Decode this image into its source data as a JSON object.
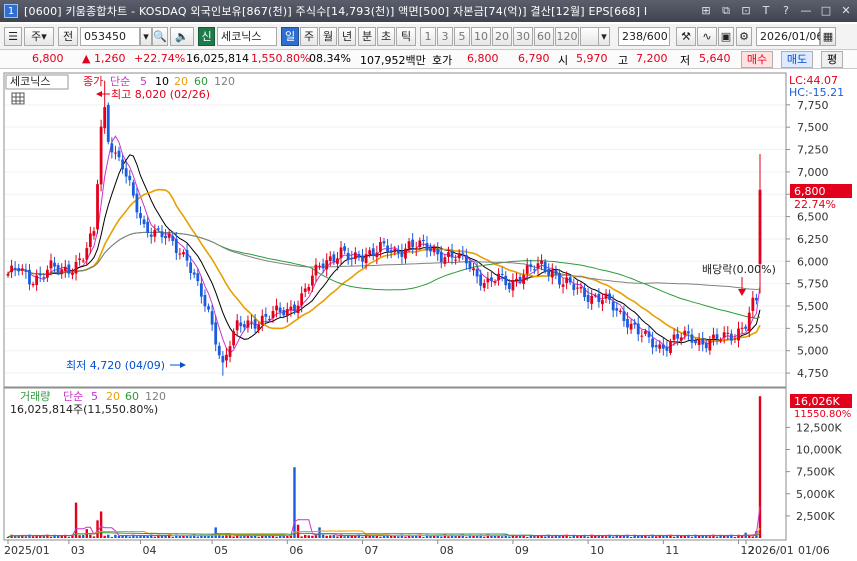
{
  "titlebar": {
    "app_number": "1",
    "title": "[0600] 키움종합차트 - KOSDAQ 외국인보유[867(천)] 주식수[14,793(천)] 액면[500] 자본금[74(억)] 결산[12월] EPS[668] I",
    "icons": [
      "link-icon",
      "restore-icon",
      "lock-icon",
      "help-icon",
      "minimize-icon",
      "maximize-icon",
      "close-icon"
    ],
    "icon_glyphs": [
      "⊞",
      "⧉",
      "⊡",
      "T",
      "?",
      "—",
      "□",
      "✕"
    ]
  },
  "toolbar": {
    "period_type": "주",
    "market": "전",
    "code": "053450",
    "stock_name": "세코닉스",
    "new_badge": "신",
    "tabs": [
      "일",
      "주",
      "월",
      "년",
      "분",
      "초",
      "틱"
    ],
    "minutes": [
      "1",
      "3",
      "5",
      "10",
      "20",
      "30",
      "60",
      "120"
    ],
    "count": "238",
    "count_total": "/600",
    "date": "2026/01/06"
  },
  "quote": {
    "price": "6,800",
    "change": "▲ 1,260",
    "change_pct": "+22.74%",
    "volume": "16,025,814",
    "volume_pct": "1,550.80%",
    "turnover": "08.34%",
    "amount": "107,952백만",
    "hoga_label": "호가",
    "ask": "6,800",
    "bid": "6,790",
    "open_label": "시",
    "open": "5,970",
    "high_label": "고",
    "high": "7,200",
    "low_label": "저",
    "low": "5,640",
    "buy_button": "매수",
    "sell_button": "매도",
    "eval_button": "평"
  },
  "price_panel": {
    "name_tag": "세코닉스",
    "legend_close": "종가",
    "legend_simple": "단순",
    "ma_periods": [
      "5",
      "10",
      "20",
      "60",
      "120"
    ],
    "lc_label": "LC:44.07",
    "hc_label": "HC:-15.21",
    "high_annotation": "최고 8,020 (02/26)",
    "low_annotation": "최저 4,720 (04/09)",
    "dividend_annotation": "배당락(0.00%)",
    "current_price_tag": "6,800",
    "current_pct_tag": "22.74%",
    "y_ticks": [
      "7,750",
      "7,500",
      "7,250",
      "7,000",
      "6,750",
      "6,500",
      "6,250",
      "6,000",
      "5,750",
      "5,500",
      "5,250",
      "5,000",
      "4,750"
    ]
  },
  "volume_panel": {
    "legend_volume": "거래량",
    "legend_simple": "단순",
    "ma_periods": [
      "5",
      "20",
      "60",
      "120"
    ],
    "volume_text": "16,025,814주(11,550.80%)",
    "current_tag": "16,026K",
    "current_pct_tag": "11550.80%",
    "y_ticks": [
      "12,500K",
      "10,000K",
      "7,500K",
      "5,000K",
      "2,500K"
    ]
  },
  "x_axis": {
    "labels": [
      "2025/01",
      "03",
      "04",
      "05",
      "06",
      "07",
      "08",
      "09",
      "10",
      "11",
      "12",
      "2026/01",
      "01/06"
    ]
  },
  "colors": {
    "up": "#e3001b",
    "down": "#1a5ce0",
    "ma5": "#cc33cc",
    "ma10": "#000000",
    "ma20": "#e8a000",
    "ma60": "#2e9a3c",
    "ma120": "#808080"
  },
  "chart_data": {
    "type": "candlestick",
    "title": "세코닉스",
    "price_range": [
      4650,
      8050
    ],
    "volume_range": [
      0,
      16500
    ],
    "high_point": {
      "date": "02/26",
      "value": 8020
    },
    "low_point": {
      "date": "04/09",
      "value": 4720
    },
    "last": {
      "date": "2026/01/06",
      "open": 5970,
      "high": 7200,
      "low": 5640,
      "close": 6800,
      "volume_k": 16026
    },
    "price_profile": [
      [
        0,
        5860
      ],
      [
        3,
        5900
      ],
      [
        6,
        5800
      ],
      [
        9,
        5850
      ],
      [
        12,
        5920
      ],
      [
        15,
        5880
      ],
      [
        18,
        5950
      ],
      [
        21,
        6050
      ],
      [
        24,
        6300
      ],
      [
        26,
        7500
      ],
      [
        27,
        7700
      ],
      [
        28,
        7400
      ],
      [
        30,
        7200
      ],
      [
        32,
        7050
      ],
      [
        35,
        6700
      ],
      [
        38,
        6400
      ],
      [
        42,
        6300
      ],
      [
        46,
        6200
      ],
      [
        50,
        6050
      ],
      [
        53,
        5700
      ],
      [
        56,
        5400
      ],
      [
        58,
        5150
      ],
      [
        60,
        4850
      ],
      [
        62,
        5100
      ],
      [
        64,
        5250
      ],
      [
        67,
        5300
      ],
      [
        70,
        5350
      ],
      [
        74,
        5400
      ],
      [
        78,
        5450
      ],
      [
        82,
        5600
      ],
      [
        85,
        5800
      ],
      [
        87,
        5950
      ],
      [
        90,
        6050
      ],
      [
        93,
        6100
      ],
      [
        96,
        6000
      ],
      [
        100,
        6100
      ],
      [
        104,
        6150
      ],
      [
        108,
        6080
      ],
      [
        112,
        6200
      ],
      [
        116,
        6150
      ],
      [
        120,
        6100
      ],
      [
        124,
        6050
      ],
      [
        128,
        6000
      ],
      [
        131,
        5850
      ],
      [
        134,
        5750
      ],
      [
        137,
        5800
      ],
      [
        140,
        5750
      ],
      [
        143,
        5850
      ],
      [
        146,
        5900
      ],
      [
        149,
        5950
      ],
      [
        152,
        5900
      ],
      [
        155,
        5750
      ],
      [
        158,
        5700
      ],
      [
        161,
        5650
      ],
      [
        164,
        5600
      ],
      [
        167,
        5550
      ],
      [
        170,
        5450
      ],
      [
        173,
        5350
      ],
      [
        176,
        5200
      ],
      [
        179,
        5100
      ],
      [
        182,
        5050
      ],
      [
        185,
        5100
      ],
      [
        188,
        5150
      ],
      [
        191,
        5150
      ],
      [
        194,
        5100
      ],
      [
        197,
        5100
      ],
      [
        200,
        5150
      ],
      [
        203,
        5200
      ],
      [
        206,
        5300
      ],
      [
        208,
        5500
      ],
      [
        209,
        5540
      ],
      [
        210,
        6800
      ]
    ],
    "volume_spikes_k": [
      [
        19,
        4000
      ],
      [
        22,
        1000
      ],
      [
        25,
        2000
      ],
      [
        26,
        3000
      ],
      [
        58,
        1200
      ],
      [
        80,
        8000
      ],
      [
        81,
        1500
      ],
      [
        87,
        1200
      ],
      [
        206,
        600
      ],
      [
        209,
        800
      ],
      [
        210,
        16026
      ]
    ]
  }
}
